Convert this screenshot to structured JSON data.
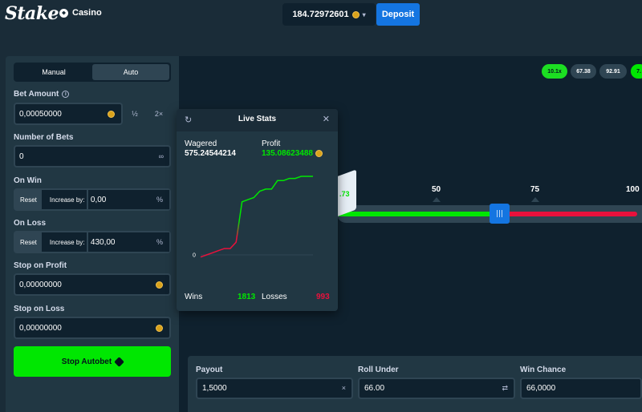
{
  "header": {
    "logo": "Stake",
    "casino_label": "Casino",
    "balance": "184.72972601",
    "deposit_label": "Deposit"
  },
  "sidebar": {
    "tabs": [
      "Manual",
      "Auto"
    ],
    "bet_amount_label": "Bet Amount",
    "bet_amount_value": "0,00050000",
    "half_label": "½",
    "double_label": "2×",
    "number_of_bets_label": "Number of Bets",
    "number_of_bets_value": "0",
    "infinity": "∞",
    "on_win_label": "On Win",
    "on_win_reset": "Reset",
    "on_win_increase_label": "Increase by:",
    "on_win_value": "0,00",
    "on_loss_label": "On Loss",
    "on_loss_reset": "Reset",
    "on_loss_increase_label": "Increase by:",
    "on_loss_value": "430,00",
    "percent": "%",
    "stop_profit_label": "Stop on Profit",
    "stop_profit_value": "0,00000000",
    "stop_loss_label": "Stop on Loss",
    "stop_loss_value": "0,00000000",
    "stop_button": "Stop Autobet"
  },
  "history": [
    {
      "value": "10.1x",
      "win": true
    },
    {
      "value": "67.38",
      "win": false
    },
    {
      "value": "92.91",
      "win": false
    },
    {
      "value": "7.",
      "win": true
    }
  ],
  "slider": {
    "ticks": [
      "50",
      "75",
      "100"
    ],
    "roll_result": ".73",
    "position": 0.66
  },
  "bottom": {
    "payout_label": "Payout",
    "payout_value": "1,5000",
    "roll_under_label": "Roll Under",
    "roll_under_value": "66.00",
    "win_chance_label": "Win Chance",
    "win_chance_value": "66,0000"
  },
  "live_stats": {
    "title": "Live Stats",
    "wagered_label": "Wagered",
    "wagered_value": "575.24544214",
    "profit_label": "Profit",
    "profit_value": "135.08623488",
    "wins_label": "Wins",
    "wins_value": "1813",
    "losses_label": "Losses",
    "losses_value": "993",
    "zero_label": "0"
  },
  "colors": {
    "green": "#00e701",
    "red": "#e9113c",
    "blue": "#1475e1",
    "bg": "#1a2c38",
    "panel": "#213743",
    "dark": "#0f212e"
  },
  "chart_data": {
    "type": "line",
    "y_zero_label": "0",
    "profit_series": [
      -1,
      0,
      1,
      2,
      3,
      3,
      6,
      25,
      26,
      27,
      30,
      31,
      31,
      35,
      35,
      36,
      36,
      37,
      37,
      37
    ],
    "ylim": [
      -3,
      40
    ]
  }
}
